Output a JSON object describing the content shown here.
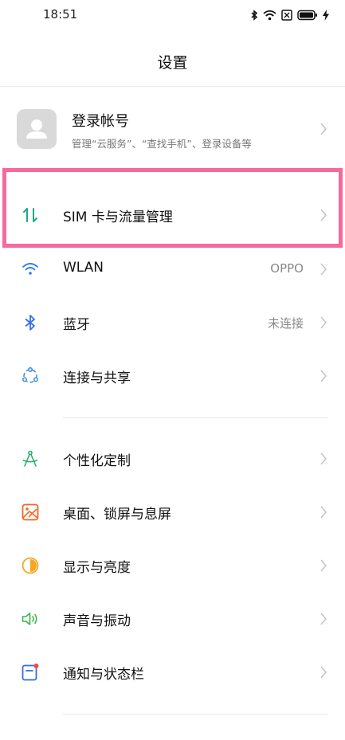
{
  "status_bar": {
    "time": "18:51",
    "icons": [
      "bluetooth-icon",
      "wifi-icon",
      "nfc-icon",
      "battery-icon",
      "charging-icon"
    ]
  },
  "header": {
    "title": "设置"
  },
  "account": {
    "name": "登录帐号",
    "description": "管理“云服务”、“查找手机”、登录设备等",
    "icon": "user-avatar-icon"
  },
  "groups": [
    {
      "items": [
        {
          "label": "SIM 卡与流量管理",
          "value": "",
          "icon": "sim-data-icon",
          "color": "#1fa68a"
        },
        {
          "label": "WLAN",
          "value": "OPPO",
          "icon": "wifi-icon",
          "color": "#2f7bf5"
        },
        {
          "label": "蓝牙",
          "value": "未连接",
          "icon": "bluetooth-icon",
          "color": "#3b6fe0"
        },
        {
          "label": "连接与共享",
          "value": "",
          "icon": "share-icon",
          "color": "#3a8bd8"
        }
      ]
    },
    {
      "items": [
        {
          "label": "个性化定制",
          "value": "",
          "icon": "compass-icon",
          "color": "#27b06a"
        },
        {
          "label": "桌面、锁屏与息屏",
          "value": "",
          "icon": "wallpaper-icon",
          "color": "#f06a2a"
        },
        {
          "label": "显示与亮度",
          "value": "",
          "icon": "brightness-icon",
          "color": "#f5a623"
        },
        {
          "label": "声音与振动",
          "value": "",
          "icon": "speaker-icon",
          "color": "#3cb34a"
        },
        {
          "label": "通知与状态栏",
          "value": "",
          "icon": "notification-icon",
          "color": "#2f6fd6"
        }
      ]
    }
  ],
  "highlight_color": "#f5699c"
}
